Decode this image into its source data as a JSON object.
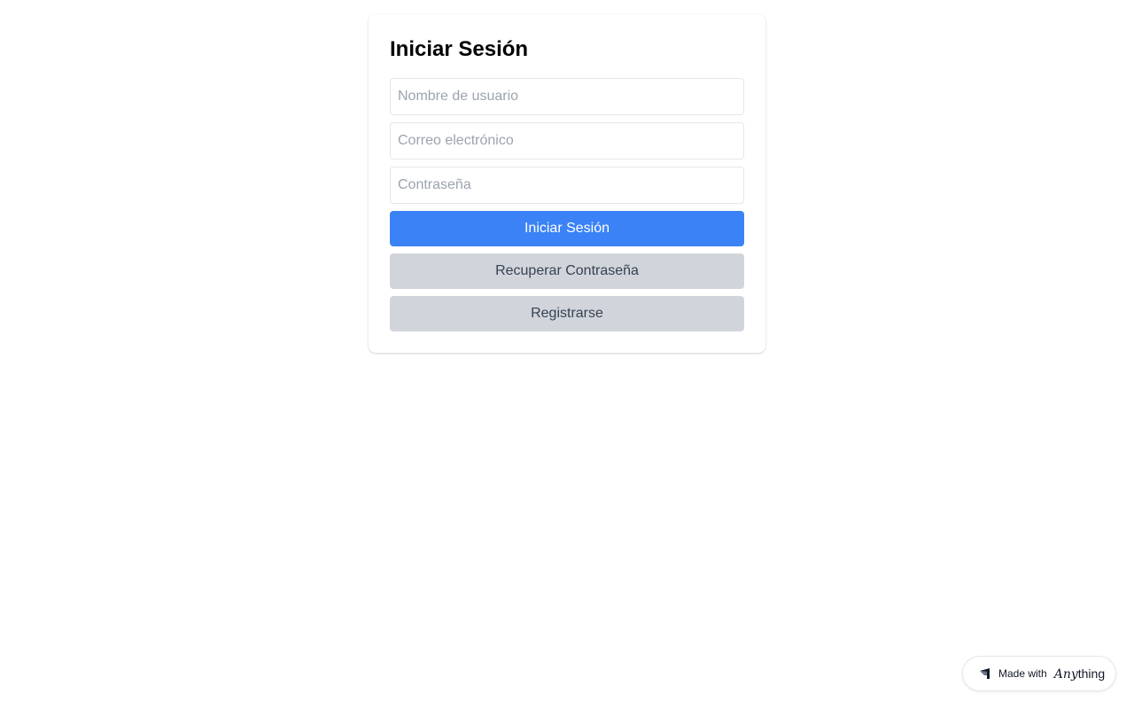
{
  "login": {
    "title": "Iniciar Sesión",
    "username_placeholder": "Nombre de usuario",
    "email_placeholder": "Correo electrónico",
    "password_placeholder": "Contraseña",
    "submit_label": "Iniciar Sesión",
    "recover_label": "Recuperar Contraseña",
    "register_label": "Registrarse"
  },
  "badge": {
    "made_with": "Made with",
    "brand_any": "Any",
    "brand_thing": "thing",
    "icon": "anything-logo-icon"
  },
  "colors": {
    "primary": "#3b82f6",
    "secondary": "#d1d5db",
    "border": "#e5e7eb"
  }
}
